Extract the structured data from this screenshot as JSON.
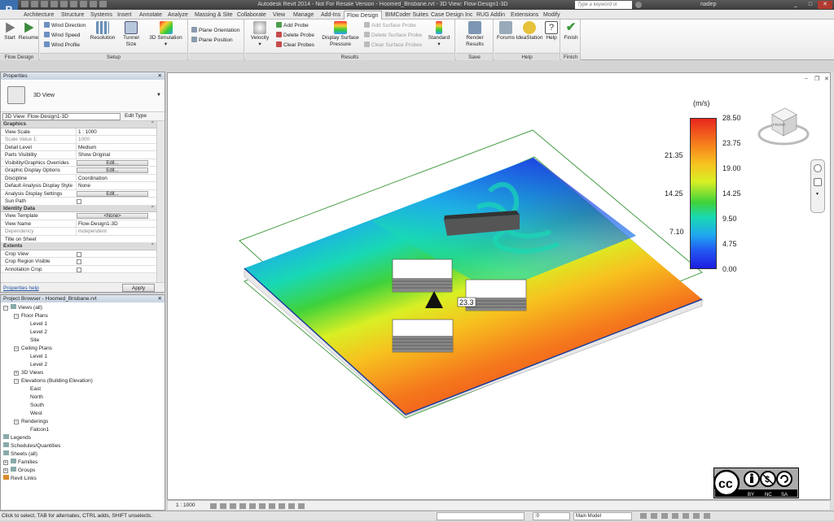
{
  "app": {
    "title": "Autodesk Revit 2014 - Not For Resale Version - Hoomed_Brisbane.rvt - 3D View: Flow-Design1-3D",
    "search_placeholder": "Type a keyword or phrase",
    "user": "nadep",
    "logo_letter": "R"
  },
  "tabs": [
    "Architecture",
    "Structure",
    "Systems",
    "Insert",
    "Annotate",
    "Analyze",
    "Massing & Site",
    "Collaborate",
    "View",
    "Manage",
    "Add-Ins",
    "Flow Design",
    "BIMCoder Suites",
    "Case Design Inc",
    "RUG Addin",
    "Extensions",
    "Modify"
  ],
  "active_tab": "Flow Design",
  "ribbon": {
    "flow_design": {
      "label": "Flow Design",
      "start": "Start",
      "resume": "Resume"
    },
    "setup": {
      "label": "Setup",
      "wind_direction": "Wind Direction",
      "wind_speed": "Wind Speed",
      "wind_profile": "Wind Profile",
      "resolution": "Resolution",
      "tunnel_size": "Tunnel Size",
      "simulation_3d": "3D Simulation",
      "plane_orientation": "Plane Orientation",
      "plane_position": "Plane Position"
    },
    "results": {
      "label": "Results",
      "velocity": "Velocity",
      "add_probe": "Add Probe",
      "delete_probe": "Delete Probe",
      "clear_probes": "Clear Probes",
      "display_surface_pressure_1": "Display Surface",
      "display_surface_pressure_2": "Pressure",
      "add_surface_probe": "Add Surface Probe",
      "delete_surface_probe": "Delete Surface Probe",
      "clear_surface_probes": "Clear Surface Probes",
      "standard": "Standard"
    },
    "save": {
      "label": "Save",
      "render_results": "Render Results"
    },
    "help": {
      "label": "Help",
      "forums": "Forums",
      "ideastation": "IdeaStation",
      "help": "Help"
    },
    "finish": {
      "label": "Finish",
      "finish": "Finish"
    }
  },
  "properties": {
    "header": "Properties",
    "type_name": "3D View",
    "selector": "3D View: Flow-Design1-3D",
    "edit_type": "Edit Type",
    "groups": {
      "graphics": "Graphics",
      "identity": "Identity Data",
      "extents": "Extents"
    },
    "rows": {
      "view_scale": {
        "k": "View Scale",
        "v": "1 : 1000"
      },
      "scale_value": {
        "k": "Scale Value    1:",
        "v": "1000"
      },
      "detail_level": {
        "k": "Detail Level",
        "v": "Medium"
      },
      "parts_visibility": {
        "k": "Parts Visibility",
        "v": "Show Original"
      },
      "vg_overrides": {
        "k": "Visibility/Graphics Overrides",
        "v": "Edit..."
      },
      "graphic_display": {
        "k": "Graphic Display Options",
        "v": "Edit..."
      },
      "discipline": {
        "k": "Discipline",
        "v": "Coordination"
      },
      "default_analysis": {
        "k": "Default Analysis Display Style",
        "v": "None"
      },
      "analysis_settings": {
        "k": "Analysis Display Settings",
        "v": "Edit..."
      },
      "sun_path": {
        "k": "Sun Path",
        "v": ""
      },
      "view_template": {
        "k": "View Template",
        "v": "<None>"
      },
      "view_name": {
        "k": "View Name",
        "v": "Flow-Design1-3D"
      },
      "dependency": {
        "k": "Dependency",
        "v": "Independent"
      },
      "title_on_sheet": {
        "k": "Title on Sheet",
        "v": ""
      },
      "crop_view": {
        "k": "Crop View",
        "v": ""
      },
      "crop_region_visible": {
        "k": "Crop Region Visible",
        "v": ""
      },
      "annotation_crop": {
        "k": "Annotation Crop",
        "v": ""
      }
    },
    "help_link": "Properties help",
    "apply": "Apply"
  },
  "browser": {
    "header": "Project Browser - Hoomed_Brisbane.rvt",
    "items": {
      "views": "Views (all)",
      "floor_plans": "Floor Plans",
      "fp_level1": "Level 1",
      "fp_level2": "Level 2",
      "fp_site": "Site",
      "ceiling_plans": "Ceiling Plans",
      "cp_level1": "Level 1",
      "cp_level2": "Level 2",
      "views_3d": "3D Views",
      "elevations": "Elevations (Building Elevation)",
      "east": "East",
      "north": "North",
      "south": "South",
      "west": "West",
      "renderings": "Renderings",
      "falcon": "Falcon1",
      "legends": "Legends",
      "schedules": "Schedules/Quantities",
      "sheets": "Sheets (all)",
      "families": "Families",
      "groups": "Groups",
      "revit_links": "Revit Links"
    }
  },
  "viewport": {
    "legend": {
      "unit": "(m/s)",
      "right_ticks": [
        "28.50",
        "23.75",
        "19.00",
        "14.25",
        "9.50",
        "4.75",
        "0.00"
      ],
      "left_ticks": [
        "21.35",
        "14.25",
        "7.10"
      ]
    },
    "probe_value": "23.3",
    "viewcube_label": "FRONT",
    "license": {
      "by": "BY",
      "nc": "NC",
      "sa": "SA"
    }
  },
  "view_bar": {
    "scale": "1 : 1000"
  },
  "status": {
    "message": "Click to select, TAB for alternates, CTRL adds, SHIFT unselects.",
    "workset_value": ":0",
    "model": "Main Model"
  },
  "colors": {
    "flow_red": "#e8261c",
    "flow_green": "#3fd23b",
    "flow_blue": "#1d1de0",
    "ribbon_bg": "#f3f3f3",
    "panel_header": "#c7d2df"
  }
}
